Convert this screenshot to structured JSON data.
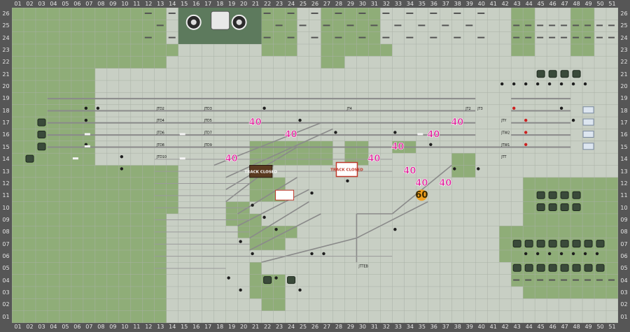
{
  "columns": [
    "01",
    "02",
    "03",
    "04",
    "05",
    "06",
    "07",
    "08",
    "09",
    "10",
    "11",
    "12",
    "13",
    "14",
    "15",
    "16",
    "17",
    "18",
    "19",
    "20",
    "21",
    "22",
    "23",
    "24",
    "25",
    "26",
    "27",
    "28",
    "29",
    "30",
    "31",
    "32",
    "33",
    "34",
    "35",
    "36",
    "37",
    "38",
    "39",
    "40",
    "41",
    "42",
    "43",
    "44",
    "45",
    "46",
    "47",
    "48",
    "49",
    "50",
    "51"
  ],
  "rows": [
    "26",
    "25",
    "24",
    "23",
    "22",
    "21",
    "20",
    "19",
    "18",
    "17",
    "16",
    "15",
    "14",
    "13",
    "12",
    "11",
    "10",
    "09",
    "08",
    "07",
    "06",
    "05",
    "04",
    "03",
    "02",
    "01"
  ],
  "colors": {
    "background": "#c8cfc4",
    "cell_line": "#a9b0a6",
    "green_fill": "#8fad78",
    "dark_panel": "#5d7a5d",
    "track": "#8a8a8a",
    "speed": "#e0209a",
    "speed_amber": "#f0a020",
    "closed_red": "#c0392b"
  },
  "speed_limits": [
    "40",
    "40",
    "40",
    "40",
    "40",
    "40",
    "40",
    "40",
    "40",
    "60",
    "40"
  ],
  "tags": {
    "track_closed_brown": "TRACK CLOSED",
    "track_closed_card": "TRACK CLOSED"
  },
  "track_labels": {
    "r18": [
      "JTD2",
      "JTD3",
      "JT4",
      "JT3",
      "JT2"
    ],
    "r17": [
      "JTD4",
      "JTD5",
      "JTY"
    ],
    "r16": [
      "JTD6",
      "JTD7",
      "JTW2"
    ],
    "r15": [
      "JTD8",
      "JTD9",
      "JTW1"
    ],
    "r14": [
      "JTD10",
      "JTT"
    ],
    "r05": [
      "JTTEB"
    ]
  }
}
